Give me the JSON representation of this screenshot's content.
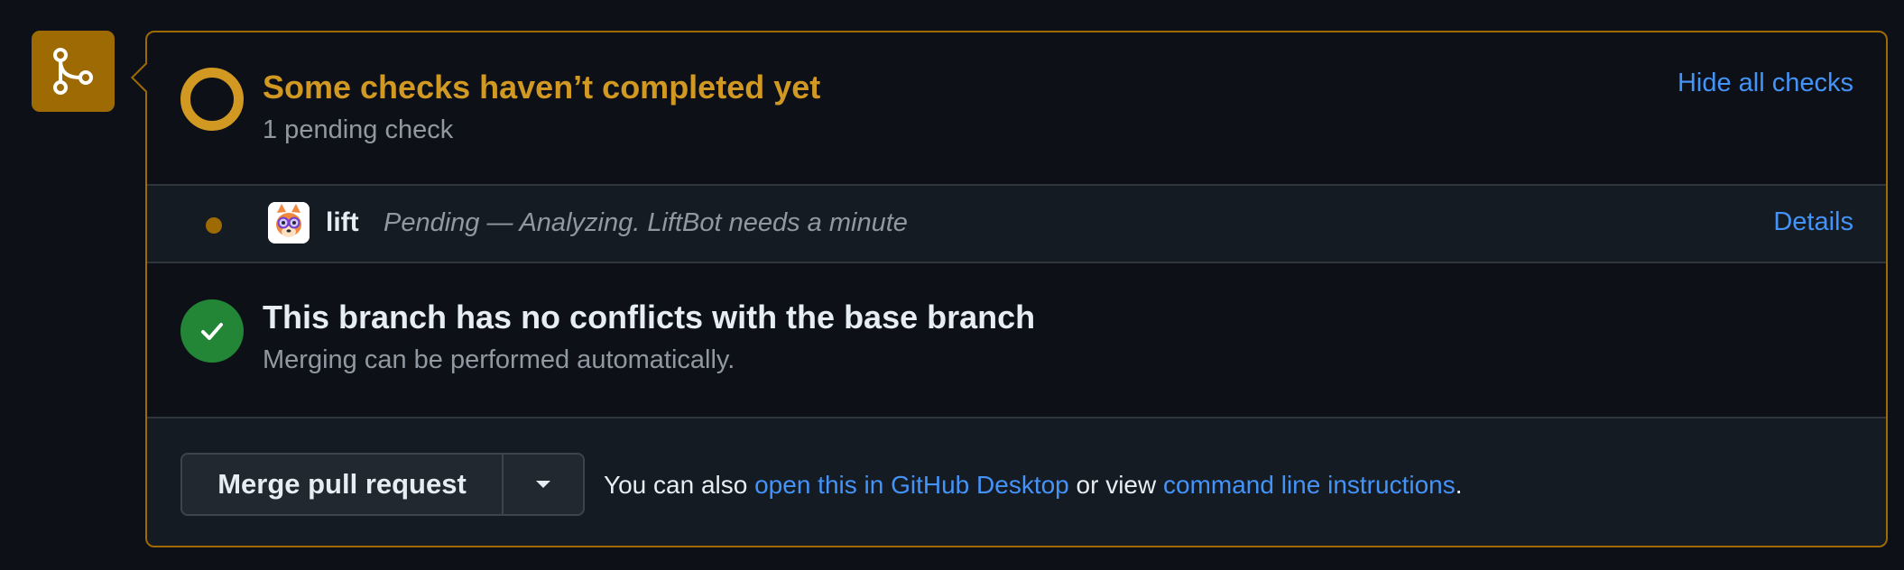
{
  "checks": {
    "title": "Some checks haven’t completed yet",
    "subtitle": "1 pending check",
    "hide_label": "Hide all checks"
  },
  "check_items": [
    {
      "name": "lift",
      "description": "Pending — Analyzing. LiftBot needs a minute",
      "details_label": "Details",
      "status": "pending"
    }
  ],
  "branch": {
    "title": "This branch has no conflicts with the base branch",
    "subtitle": "Merging can be performed automatically."
  },
  "merge": {
    "button_label": "Merge pull request",
    "prefix": "You can also",
    "desktop_link": "open this in GitHub Desktop",
    "middle": "or view",
    "cli_link": "command line instructions",
    "suffix": "."
  },
  "colors": {
    "pending": "#d29922",
    "pending_dark": "#9e6a03",
    "success": "#238636",
    "link": "#4493f8",
    "background": "#0d1117",
    "border": "#30363d"
  },
  "icons": {
    "merge_badge": "git-merge-icon",
    "pending_status": "pending-ring-icon",
    "item_status": "pending-dot-icon",
    "app_avatar": "liftbot-avatar",
    "branch_status": "check-circle-icon",
    "dropdown": "triangle-down-icon"
  }
}
